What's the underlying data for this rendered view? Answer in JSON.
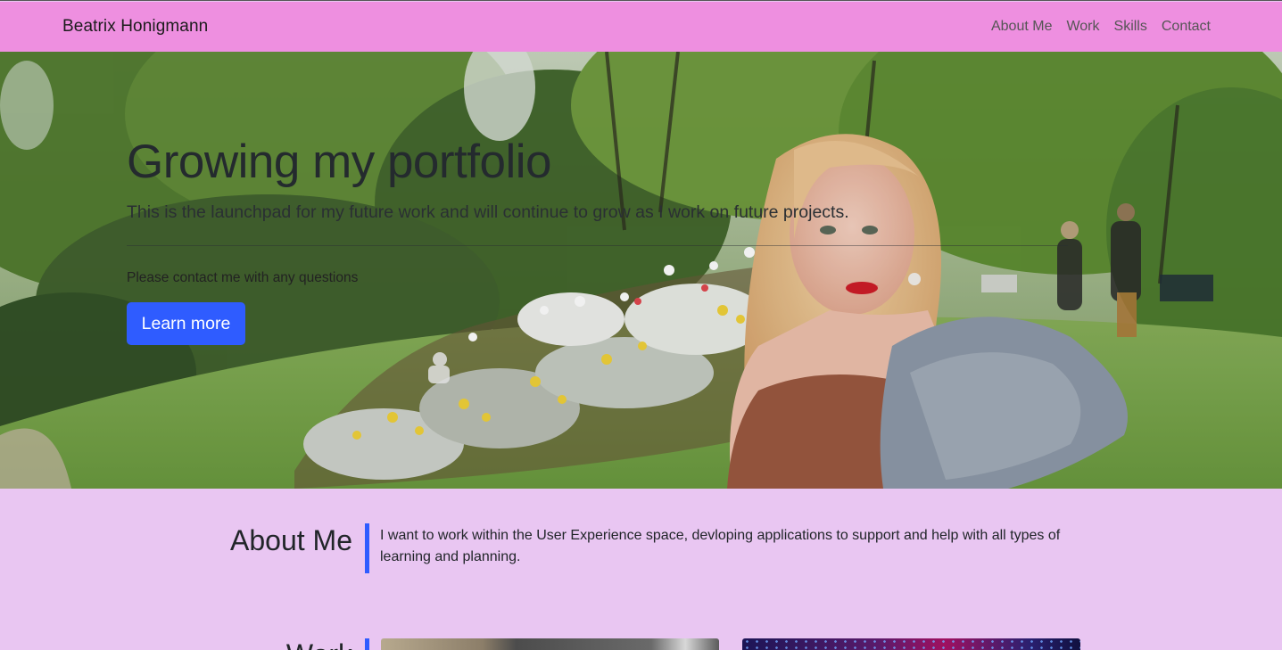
{
  "navbar": {
    "brand": "Beatrix Honigmann",
    "links": [
      "About Me",
      "Work",
      "Skills",
      "Contact"
    ],
    "background": "#ee8fe0"
  },
  "hero": {
    "title": "Growing my portfolio",
    "lead": "This is the launchpad for my future work and will continue to grow as I work on future projects.",
    "note": "Please contact me with any questions",
    "button_label": "Learn more",
    "button_color": "#2f5cff"
  },
  "about": {
    "heading": "About Me",
    "text": "I want to work within the User Experience space, devloping applications to support and help with all types of learning and planning."
  },
  "work": {
    "heading": "Work"
  },
  "colors": {
    "page_background": "#e9c6f2",
    "accent": "#2f5cff"
  }
}
